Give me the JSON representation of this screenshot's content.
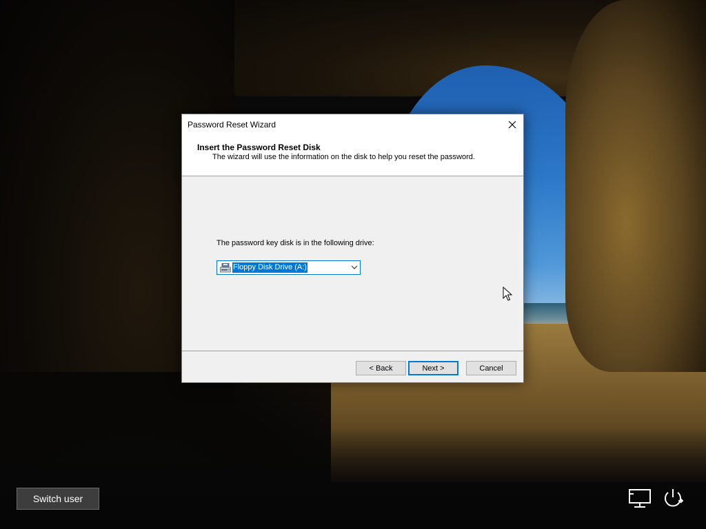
{
  "dialog": {
    "title": "Password Reset Wizard",
    "close_icon": "close-icon",
    "header_title": "Insert the Password Reset Disk",
    "header_subtitle": "The wizard will use the information on the disk to help you reset the password.",
    "drive_label": "The password key disk is in the following drive:",
    "drive_select": {
      "selected": "Floppy Disk Drive (A:)",
      "icon": "floppy-drive-icon"
    },
    "buttons": {
      "back": "< Back",
      "next": "Next >",
      "cancel": "Cancel"
    }
  },
  "lockscreen": {
    "switch_user": "Switch user",
    "network_icon": "network-icon",
    "power_icon": "power-icon"
  },
  "colors": {
    "accent": "#0078d7",
    "dialog_bg": "#f0f0f0",
    "button_bg": "#e1e1e1"
  }
}
